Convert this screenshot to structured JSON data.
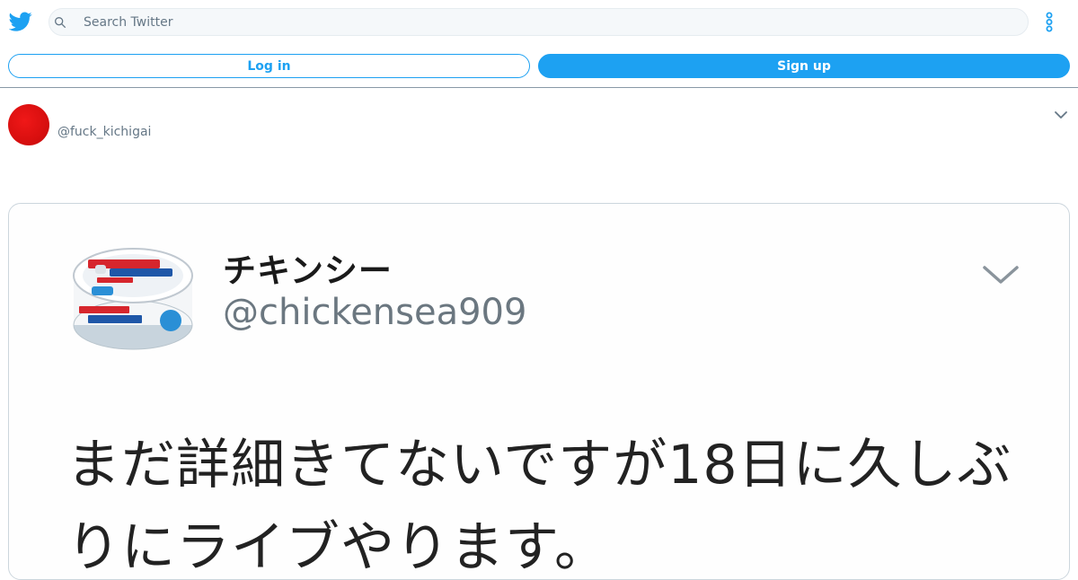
{
  "search": {
    "placeholder": "Search Twitter"
  },
  "buttons": {
    "login": "Log in",
    "signup": "Sign up"
  },
  "tweet": {
    "handle": "@fuck_kichigai"
  },
  "embedded": {
    "name": "チキンシー",
    "handle": "@chickensea909",
    "text": "まだ詳細きてないですが18日に久しぶりにライブやります。"
  },
  "colors": {
    "brand": "#1da1f2",
    "secondary_text": "#657786",
    "avatar_red": "#e01515"
  },
  "icons": {
    "logo": "twitter-bird-icon",
    "search": "search-icon",
    "more": "more-vertical-icon",
    "caret": "chevron-down-icon"
  }
}
